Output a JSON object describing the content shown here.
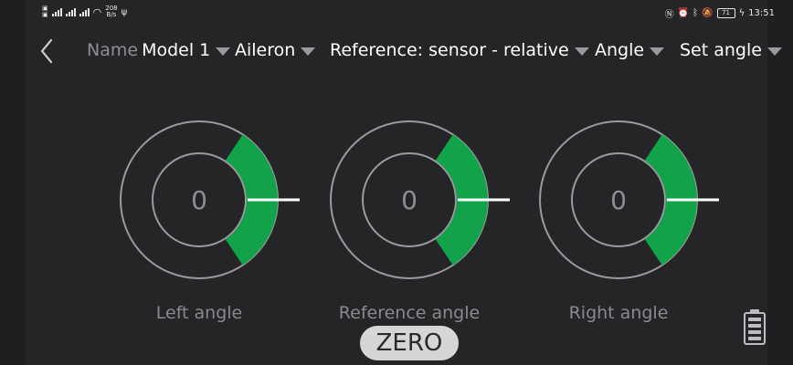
{
  "status_bar": {
    "network_speed_top": "208",
    "network_speed_bottom": "B/s",
    "battery_level": "71",
    "time": "13:51"
  },
  "toolbar": {
    "name_label": "Name",
    "model": "Model 1",
    "surface": "Aileron",
    "reference": "Reference: sensor - relative",
    "measure": "Angle",
    "mode": "Set angle"
  },
  "gauges": [
    {
      "label": "Left angle",
      "value": "0"
    },
    {
      "label": "Reference angle",
      "value": "0"
    },
    {
      "label": "Right angle",
      "value": "0"
    }
  ],
  "actions": {
    "zero_label": "ZERO"
  },
  "colors": {
    "background": "#252527",
    "gauge_fill": "#12a24a",
    "gauge_ring": "#9b9b9f",
    "needle": "#ffffff",
    "button_bg": "#d6d6d8"
  }
}
